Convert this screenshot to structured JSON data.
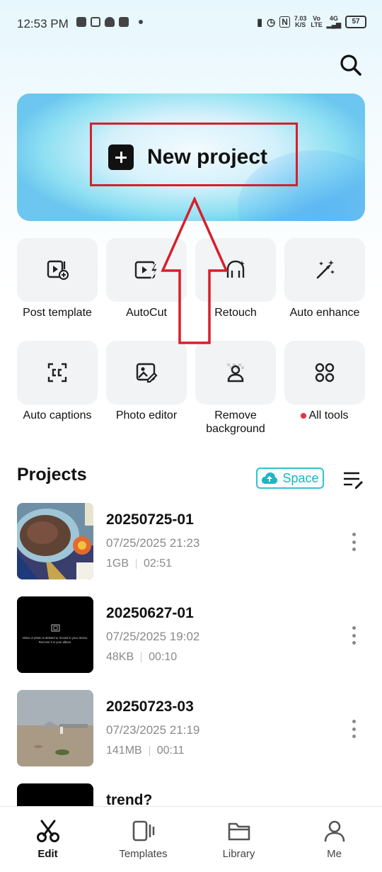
{
  "status": {
    "time": "12:53 PM",
    "net_speed_top": "7.03",
    "net_speed_bottom": "K/S",
    "volte_top": "Vo",
    "volte_bottom": "LTE",
    "network": "4G",
    "battery": "57"
  },
  "hero": {
    "new_project_label": "New project"
  },
  "tools": [
    {
      "label": "Post template",
      "icon": "post-template-icon"
    },
    {
      "label": "AutoCut",
      "icon": "autocut-icon"
    },
    {
      "label": "Retouch",
      "icon": "retouch-icon"
    },
    {
      "label": "Auto enhance",
      "icon": "magic-wand-icon"
    },
    {
      "label": "Auto captions",
      "icon": "captions-icon"
    },
    {
      "label": "Photo editor",
      "icon": "photo-editor-icon"
    },
    {
      "label": "Remove background",
      "icon": "remove-background-icon"
    },
    {
      "label": "All tools",
      "icon": "grid-icon",
      "badge": true
    }
  ],
  "projects": {
    "title": "Projects",
    "space_label": "Space",
    "items": [
      {
        "name": "20250725-01",
        "date": "07/25/2025 21:23",
        "size": "1GB",
        "duration": "02:51"
      },
      {
        "name": "20250627-01",
        "date": "07/25/2025 19:02",
        "size": "48KB",
        "duration": "00:10"
      },
      {
        "name": "20250723-03",
        "date": "07/23/2025 21:19",
        "size": "141MB",
        "duration": "00:11"
      },
      {
        "name": "trend?",
        "date": "",
        "size": "",
        "duration": ""
      }
    ],
    "missing_media_text_1": "Video or photo is deleted or moved in your device.",
    "missing_media_text_2": "Recover it in your album."
  },
  "tabs": [
    {
      "label": "Edit",
      "icon": "scissors-icon",
      "active": true
    },
    {
      "label": "Templates",
      "icon": "templates-icon",
      "active": false
    },
    {
      "label": "Library",
      "icon": "folder-icon",
      "active": false
    },
    {
      "label": "Me",
      "icon": "person-icon",
      "active": false
    }
  ],
  "colors": {
    "accent": "#1fb5c2",
    "highlight": "#d81f2a",
    "badge": "#e8323c"
  }
}
